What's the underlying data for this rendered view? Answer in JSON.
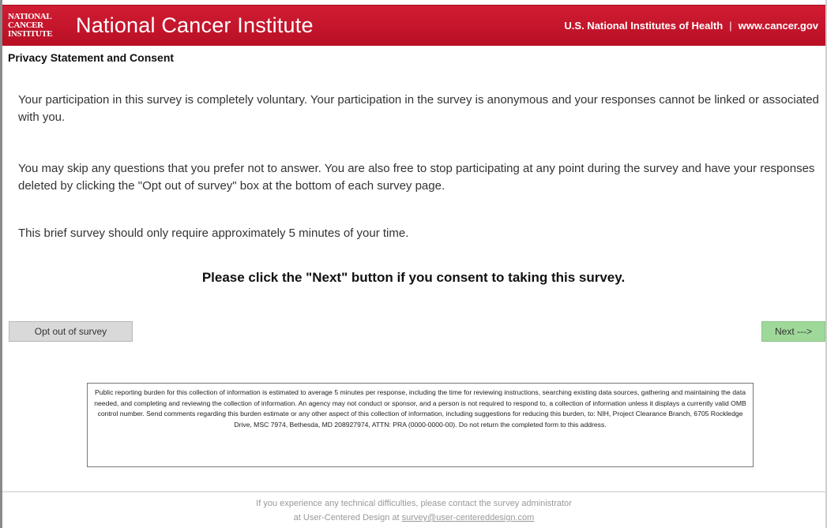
{
  "header": {
    "logo_lines": [
      "NATIONAL",
      "CANCER",
      "INSTITUTE"
    ],
    "institute_name": "National Cancer Institute",
    "nih_text": "U.S. National Institutes of Health",
    "separator": "|",
    "site_url": "www.cancer.gov",
    "brand_color": "#c8102e"
  },
  "page_title": "Privacy Statement and Consent",
  "paragraphs": [
    "Your participation in this survey is completely voluntary. Your participation in the survey is anonymous and your responses cannot be linked or associated with you.",
    "You may skip any questions that you prefer not to answer. You are also free to stop participating at any point during the survey and have your responses deleted by clicking the \"Opt out of survey\" box at the bottom of each survey page.",
    "This brief survey should only require approximately 5 minutes of your time."
  ],
  "consent_prompt": "Please click the \"Next\" button if you consent to taking this survey.",
  "buttons": {
    "opt_out": "Opt out of survey",
    "next": "Next --->"
  },
  "burden_statement": "Public reporting burden for this collection of information is estimated to average 5 minutes per response, including the time for reviewing instructions, searching existing data sources, gathering and maintaining the data needed, and completing and reviewing the collection of information. An agency may not conduct or sponsor, and a person is not required to respond to, a collection of information unless it displays a currently valid OMB control number. Send comments regarding this burden estimate or any other aspect of this collection of information, including suggestions for reducing this burden, to: NIH, Project Clearance Branch, 6705 Rockledge Drive, MSC 7974, Bethesda, MD 208927974, ATTN: PRA (0000-0000-00). Do not return the completed form to this address.",
  "footer": {
    "line1": "If you experience any technical difficulties, please contact the survey administrator",
    "line2_prefix": "at User-Centered Design at",
    "email": "survey@user-centereddesign.com"
  }
}
